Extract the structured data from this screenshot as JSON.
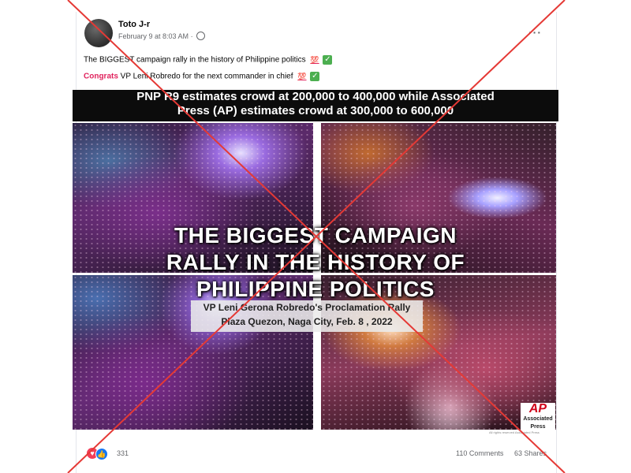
{
  "post": {
    "author": "Toto J-r",
    "timestamp": "February 9 at 8:03 AM",
    "audience_icon": "globe-icon",
    "more_label": "···",
    "line1_text": "The BIGGEST campaign rally in the history of Philippine politics",
    "line1_emoji": "💯",
    "line2_prefix": "Congrats",
    "line2_text": " VP Leni Robredo for the next commander in chief",
    "line2_emoji": "💯",
    "check": "✓"
  },
  "image": {
    "banner_line1": "PNP R9 estimates crowd at 200,000 to 400,000 while Associated",
    "banner_line2": "Press (AP) estimates crowd at 300,000 to 600,000",
    "title_line1": "THE BIGGEST CAMPAIGN",
    "title_line2": "RALLY IN THE HISTORY OF",
    "title_line3": "PHILIPPINE POLITICS",
    "caption_line1": "VP Leni Gerona Robredo's Proclamation Rally",
    "caption_line2": "Plaza Quezon, Naga City, Feb. 8 , 2022",
    "ap_logo": "AP",
    "ap_sub_line1": "Associated",
    "ap_sub_line2": "Press",
    "rights": "All rights reserved Associated Press"
  },
  "footer": {
    "reaction_count": "331",
    "comments": "110 Comments",
    "shares": "63 Shares"
  },
  "colors": {
    "cross": "#e53935",
    "congrats": "#e0245e",
    "like_blue": "#1877f2",
    "heart_red": "#f33e58",
    "check_green": "#4caf50"
  }
}
